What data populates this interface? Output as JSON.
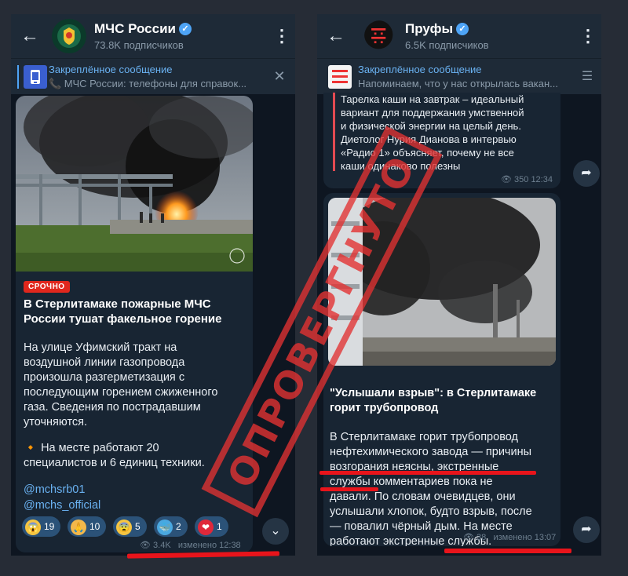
{
  "left_screen": {
    "channel_name": "МЧС России",
    "subscribers": "73.8K подписчиков",
    "pinned_title": "Закреплённое сообщение",
    "pinned_text": "📞 МЧС России: телефоны для справок...",
    "post": {
      "urgent_badge": "СРОЧНО",
      "headline_line1": "В Стерлитамаке пожарные МЧС",
      "headline_line2": "России тушат факельное горение",
      "body_lines": [
        "На улице Уфимский тракт на",
        "воздушной линии газопровода",
        "произошла разгерметизация с",
        "последующим горением сжиженного",
        "газа. Сведения по пострадавшим",
        "уточняются."
      ],
      "bullet_lines": [
        "🔸 На месте работают 20",
        "специалистов и 6 единиц техники."
      ],
      "links": [
        "@mchsrb01",
        "@mchs_official"
      ],
      "reactions": [
        {
          "emoji": "😱",
          "count": "19"
        },
        {
          "emoji": "🙏",
          "count": "10"
        },
        {
          "emoji": "😨",
          "count": "5"
        },
        {
          "emoji": "🐳",
          "count": "2"
        },
        {
          "emoji": "❤",
          "count": "1"
        }
      ],
      "views": "3.4K",
      "edited_time": "изменено 12:38"
    }
  },
  "right_screen": {
    "channel_name": "Пруфы",
    "subscribers": "6.5K подписчиков",
    "pinned_title": "Закреплённое сообщение",
    "pinned_text": "Напоминаем, что у нас открылась вакан...",
    "prev_post_lines": [
      "Тарелка каши на завтрак – идеальный",
      "вариант для поддержания умственной",
      "и физической энергии на целый день.",
      "Диетолог Нурия Дианова в интервью",
      "«Радио 1» объясняет, почему не все",
      "каши одинаково полезны"
    ],
    "prev_post_meta": "350 12:34",
    "post": {
      "headline_line1": "\"Услышали взрыв\": в Стерлитамаке",
      "headline_line2": "горит трубопровод",
      "body_lines": [
        "В Стерлитамаке горит трубопровод",
        "нефтехимического завода — причины",
        "возгорания неясны, экстренные",
        "службы комментариев пока не",
        "давали. По словам очевидцев, они",
        "услышали хлопок, будто взрыв, после",
        "— повалил чёрный дым. На месте",
        "работают экстренные службы."
      ],
      "views": "38",
      "edited_time": "изменено 13:07"
    }
  },
  "stamp_text": "ОПРОВЕРГНУТО",
  "colors": {
    "accent_blue": "#4ea4f6",
    "link_blue": "#6ab2f2",
    "bubble": "#182533",
    "chat_bg": "#0e1621",
    "header": "#1e2a37",
    "underline_red": "#e8141b",
    "stamp_red": "#e23232"
  },
  "icons": {
    "back": "arrow-left-icon",
    "menu": "kebab-menu-icon",
    "close": "close-icon",
    "share": "share-arrow-icon",
    "scroll": "chevron-down-icon",
    "views": "eye-icon",
    "verified": "verified-check-icon"
  }
}
